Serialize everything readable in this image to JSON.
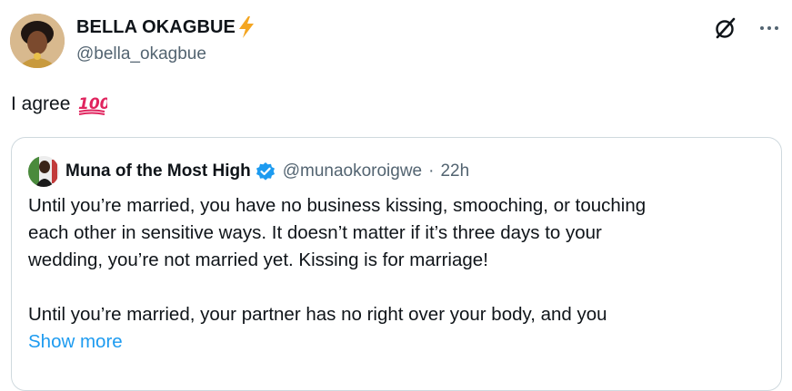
{
  "author": {
    "display_name": "BELLA OKAGBUE",
    "name_emoji": "lightning-bolt",
    "handle": "@bella_okagbue"
  },
  "tweet": {
    "text": "I agree",
    "emoji": "hundred-points"
  },
  "quoted_tweet": {
    "display_name": "Muna of the Most High",
    "verified": true,
    "handle": "@munaokoroigwe",
    "separator": "·",
    "time": "22h",
    "paragraph_1": [
      "Until you’re married, you have no business kissing, smooching, or touching",
      "each other in sensitive ways. It doesn’t matter if it’s three days to your",
      "wedding, you’re not married yet. Kissing is for marriage!"
    ],
    "paragraph_2": [
      "Until you’re married, your partner has no right over your body, and you"
    ],
    "show_more_label": "Show more"
  },
  "colors": {
    "text": "#0f1419",
    "secondary": "#536471",
    "link": "#1d9bf0",
    "verified": "#1d9bf0",
    "border": "#cfd9de"
  },
  "icons": [
    "grok-icon",
    "more-icon",
    "verified-badge-icon",
    "lightning-emoji-icon",
    "hundred-emoji-icon"
  ]
}
